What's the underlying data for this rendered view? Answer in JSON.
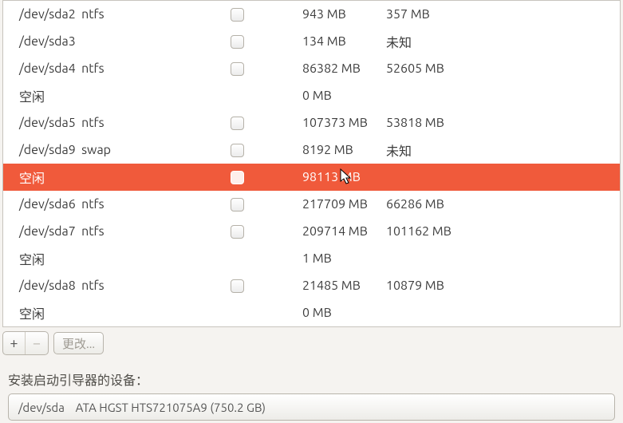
{
  "partitions": [
    {
      "device": "/dev/sda2  ntfs",
      "size": "943 MB",
      "used": "357 MB",
      "selected": false,
      "hasCheckbox": true
    },
    {
      "device": "/dev/sda3",
      "size": "134 MB",
      "used": "未知",
      "selected": false,
      "hasCheckbox": true
    },
    {
      "device": "/dev/sda4  ntfs",
      "size": "86382 MB",
      "used": "52605 MB",
      "selected": false,
      "hasCheckbox": true
    },
    {
      "device": "空闲",
      "size": "0 MB",
      "used": "",
      "selected": false,
      "hasCheckbox": false
    },
    {
      "device": "/dev/sda5  ntfs",
      "size": "107373 MB",
      "used": "53818 MB",
      "selected": false,
      "hasCheckbox": true
    },
    {
      "device": "/dev/sda9  swap",
      "size": "8192 MB",
      "used": "未知",
      "selected": false,
      "hasCheckbox": true
    },
    {
      "device": "空闲",
      "size": "98113 MB",
      "used": "",
      "selected": true,
      "hasCheckbox": false
    },
    {
      "device": "/dev/sda6  ntfs",
      "size": "217709 MB",
      "used": "66286 MB",
      "selected": false,
      "hasCheckbox": true
    },
    {
      "device": "/dev/sda7  ntfs",
      "size": "209714 MB",
      "used": "101162 MB",
      "selected": false,
      "hasCheckbox": true
    },
    {
      "device": "空闲",
      "size": "1 MB",
      "used": "",
      "selected": false,
      "hasCheckbox": false
    },
    {
      "device": "/dev/sda8  ntfs",
      "size": "21485 MB",
      "used": "10879 MB",
      "selected": false,
      "hasCheckbox": true
    },
    {
      "device": "空闲",
      "size": "0 MB",
      "used": "",
      "selected": false,
      "hasCheckbox": false
    }
  ],
  "toolbar": {
    "plus": "+",
    "minus": "−",
    "change": "更改..."
  },
  "bootloader_label": "安装启动引导器的设备：",
  "bootloader_device": "/dev/sda    ATA HGST HTS721075A9 (750.2 GB)"
}
